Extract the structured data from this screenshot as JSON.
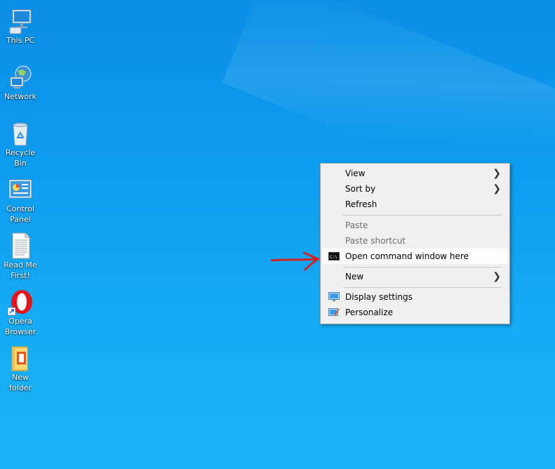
{
  "desktop": {
    "icons": [
      {
        "label": "This PC",
        "icon": "this-pc-icon"
      },
      {
        "label": "Network",
        "icon": "network-icon"
      },
      {
        "label": "Recycle Bin",
        "icon": "recycle-bin-icon"
      },
      {
        "label": "Control Panel",
        "icon": "control-panel-icon"
      },
      {
        "label": "Read Me First!",
        "icon": "text-document-icon"
      },
      {
        "label": "Opera Browser",
        "icon": "opera-icon"
      },
      {
        "label": "New folder",
        "icon": "folder-icon"
      }
    ]
  },
  "context_menu": {
    "view": "View",
    "sort_by": "Sort by",
    "refresh": "Refresh",
    "paste": "Paste",
    "paste_shortcut": "Paste shortcut",
    "open_cmd": "Open command window here",
    "new": "New",
    "display_settings": "Display settings",
    "personalize": "Personalize"
  },
  "annotation": {
    "arrow_color": "#d32020"
  },
  "colors": {
    "desktop_bg": "#0e9cef",
    "menu_bg": "#f0f0f0",
    "highlight": "#fdfdfd"
  }
}
